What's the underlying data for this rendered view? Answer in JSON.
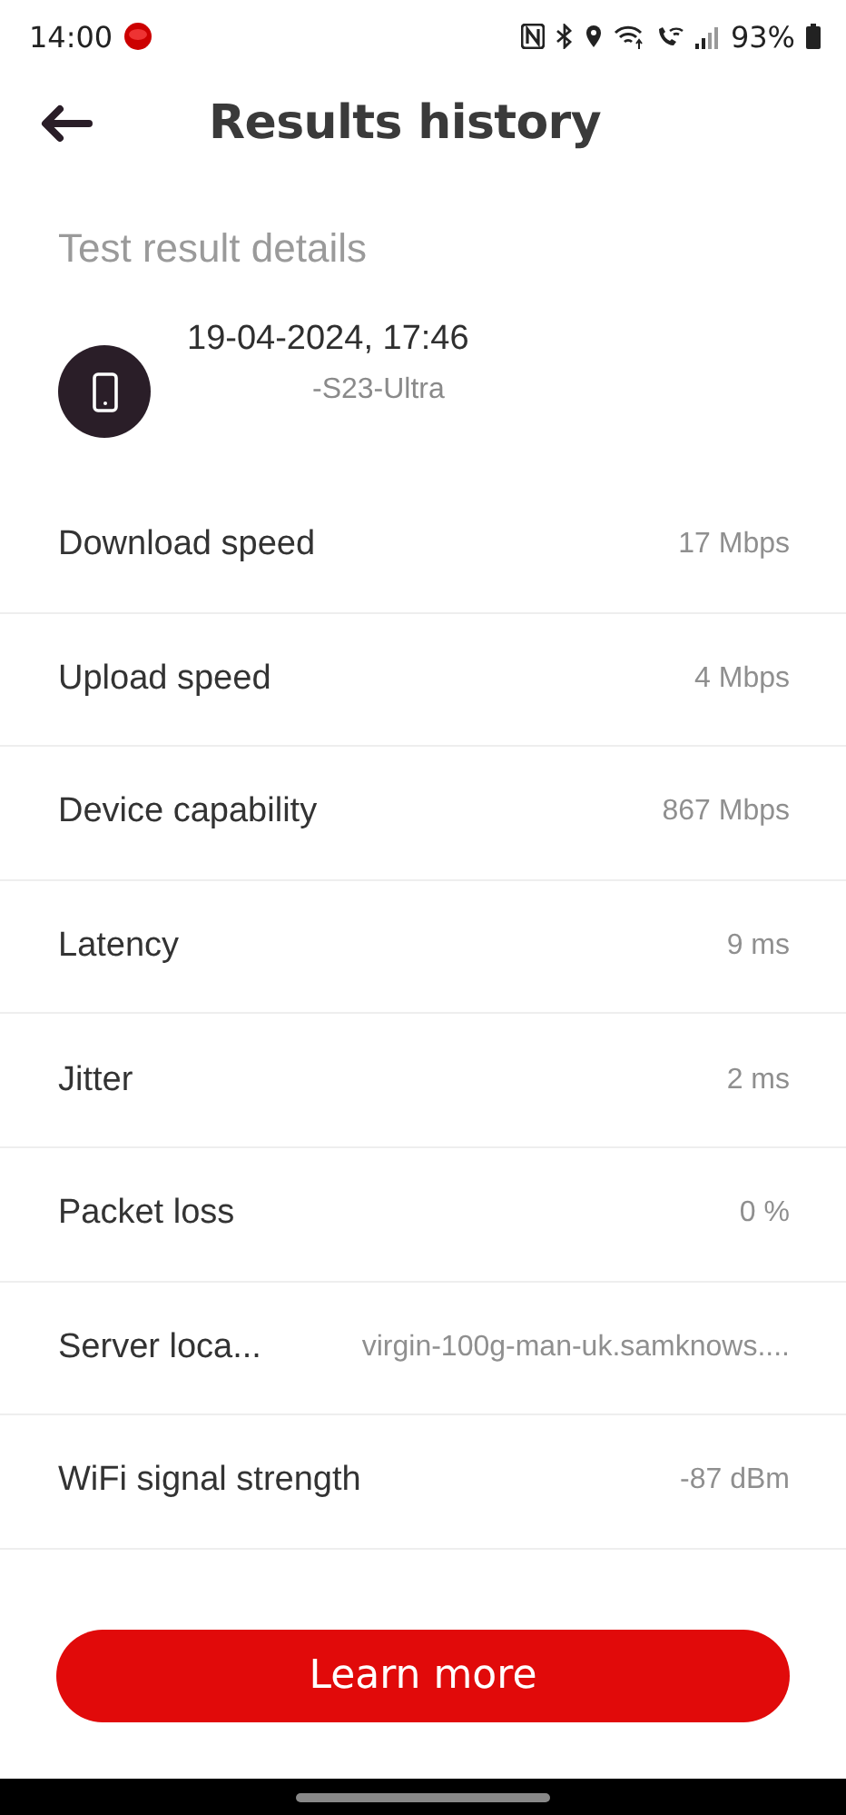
{
  "status_bar": {
    "time": "14:00",
    "battery": "93%"
  },
  "header": {
    "title": "Results history"
  },
  "section_title": "Test result details",
  "test": {
    "datetime": "19-04-2024, 17:46",
    "device": "-S23-Ultra"
  },
  "metrics": [
    {
      "label": "Download speed",
      "value": "17 Mbps"
    },
    {
      "label": "Upload speed",
      "value": "4 Mbps"
    },
    {
      "label": "Device capability",
      "value": "867 Mbps"
    },
    {
      "label": "Latency",
      "value": "9 ms"
    },
    {
      "label": "Jitter",
      "value": "2 ms"
    },
    {
      "label": "Packet loss",
      "value": "0 %"
    },
    {
      "label": "Server loca...",
      "value": "virgin-100g-man-uk.samknows...."
    },
    {
      "label": "WiFi signal strength",
      "value": "-87 dBm"
    }
  ],
  "button": "Learn more"
}
